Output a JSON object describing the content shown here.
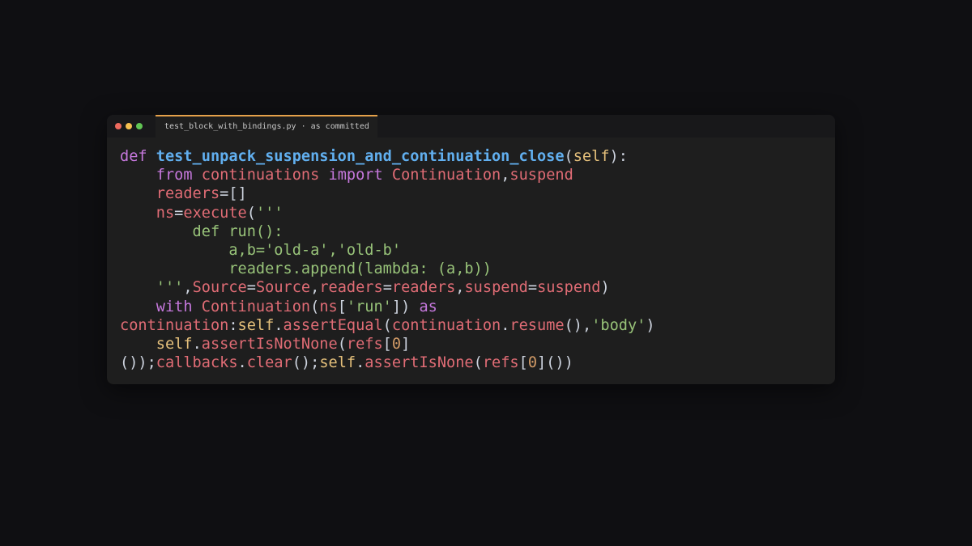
{
  "window": {
    "tab_title": "test_block_with_bindings.py · as committed",
    "traffic_lights": [
      "#ed6a5e",
      "#f5bf4f",
      "#61c554"
    ]
  },
  "code_lines": [
    [
      [
        "def ",
        "kw"
      ],
      [
        "test_unpack_suspension_and_continuation_close",
        "fn"
      ],
      [
        "(",
        "p"
      ],
      [
        "self",
        "self"
      ],
      [
        "):",
        "p"
      ]
    ],
    [
      [
        "    ",
        "p"
      ],
      [
        "from ",
        "kw"
      ],
      [
        "continuations ",
        "var"
      ],
      [
        "import ",
        "kw"
      ],
      [
        "Continuation",
        "var"
      ],
      [
        ",",
        "p"
      ],
      [
        "suspend",
        "var"
      ]
    ],
    [
      [
        "    ",
        "p"
      ],
      [
        "readers",
        "var"
      ],
      [
        "=[]",
        "p"
      ]
    ],
    [
      [
        "    ",
        "p"
      ],
      [
        "ns",
        "var"
      ],
      [
        "=",
        "p"
      ],
      [
        "execute",
        "var"
      ],
      [
        "(",
        "p"
      ],
      [
        "'''",
        "str"
      ]
    ],
    [
      [
        "        def run():",
        "str"
      ]
    ],
    [
      [
        "            a,b='old-a','old-b'",
        "str"
      ]
    ],
    [
      [
        "            readers.append(lambda: (a,b))",
        "str"
      ]
    ],
    [
      [
        "    ",
        "p"
      ],
      [
        "'''",
        "str"
      ],
      [
        ",",
        "p"
      ],
      [
        "Source",
        "var"
      ],
      [
        "=",
        "p"
      ],
      [
        "Source",
        "var"
      ],
      [
        ",",
        "p"
      ],
      [
        "readers",
        "var"
      ],
      [
        "=",
        "p"
      ],
      [
        "readers",
        "var"
      ],
      [
        ",",
        "p"
      ],
      [
        "suspend",
        "var"
      ],
      [
        "=",
        "p"
      ],
      [
        "suspend",
        "var"
      ],
      [
        ")",
        "p"
      ]
    ],
    [
      [
        "    ",
        "p"
      ],
      [
        "with ",
        "kw"
      ],
      [
        "Continuation",
        "var"
      ],
      [
        "(",
        "p"
      ],
      [
        "ns",
        "var"
      ],
      [
        "[",
        "p"
      ],
      [
        "'run'",
        "str"
      ],
      [
        "]) ",
        "p"
      ],
      [
        "as",
        "kw"
      ]
    ],
    [
      [
        "continuation",
        "var"
      ],
      [
        ":",
        "p"
      ],
      [
        "self",
        "self"
      ],
      [
        ".",
        "p"
      ],
      [
        "assertEqual",
        "var"
      ],
      [
        "(",
        "p"
      ],
      [
        "continuation",
        "var"
      ],
      [
        ".",
        "p"
      ],
      [
        "resume",
        "var"
      ],
      [
        "(),",
        "p"
      ],
      [
        "'body'",
        "str"
      ],
      [
        ")",
        "p"
      ]
    ],
    [
      [
        "    ",
        "p"
      ],
      [
        "self",
        "self"
      ],
      [
        ".",
        "p"
      ],
      [
        "assertIsNotNone",
        "var"
      ],
      [
        "(",
        "p"
      ],
      [
        "refs",
        "var"
      ],
      [
        "[",
        "p"
      ],
      [
        "0",
        "num"
      ],
      [
        "]",
        "p"
      ]
    ],
    [
      [
        "());",
        "p"
      ],
      [
        "callbacks",
        "var"
      ],
      [
        ".",
        "p"
      ],
      [
        "clear",
        "var"
      ],
      [
        "();",
        "p"
      ],
      [
        "self",
        "self"
      ],
      [
        ".",
        "p"
      ],
      [
        "assertIsNone",
        "var"
      ],
      [
        "(",
        "p"
      ],
      [
        "refs",
        "var"
      ],
      [
        "[",
        "p"
      ],
      [
        "0",
        "num"
      ],
      [
        "]())",
        "p"
      ]
    ]
  ],
  "token_colors": {
    "kw": "#c678dd",
    "fn": "#61afef",
    "self": "#e5c07b",
    "var": "#e06c75",
    "str": "#98c379",
    "num": "#d19a66",
    "p": "#cdd3de"
  }
}
